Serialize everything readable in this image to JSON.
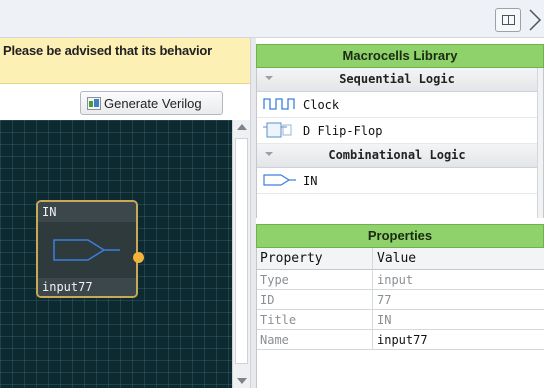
{
  "toolbar": {
    "layout_toggle_icon": "split-panel-icon",
    "collapse_icon": "chevron-right-icon"
  },
  "notice": {
    "text": "Please be advised that its behavior"
  },
  "actions": {
    "generate_label": "Generate Verilog",
    "generate_icon": "verilog-generate-icon"
  },
  "canvas": {
    "node": {
      "title": "IN",
      "name": "input77",
      "symbol": "input-pin-icon"
    }
  },
  "library": {
    "title": "Macrocells Library",
    "categories": [
      {
        "label": "Sequential Logic",
        "items": [
          {
            "label": "Clock",
            "icon": "clock-wave-icon"
          },
          {
            "label": "D Flip-Flop",
            "icon": "d-flipflop-icon"
          }
        ]
      },
      {
        "label": "Combinational Logic",
        "items": [
          {
            "label": "IN",
            "icon": "input-pin-icon"
          }
        ]
      }
    ]
  },
  "properties": {
    "title": "Properties",
    "columns": [
      "Property",
      "Value"
    ],
    "rows": [
      {
        "property": "Type",
        "value": "input",
        "editable": false
      },
      {
        "property": "ID",
        "value": "77",
        "editable": false
      },
      {
        "property": "Title",
        "value": "IN",
        "editable": false
      },
      {
        "property": "Name",
        "value": "input77",
        "editable": true
      }
    ]
  },
  "colors": {
    "header_green": "#8fd16b",
    "notice_yellow": "#fdf0b4",
    "canvas_bg": "#0e2a31",
    "node_border": "#c9a85a",
    "port": "#f4b43a"
  }
}
